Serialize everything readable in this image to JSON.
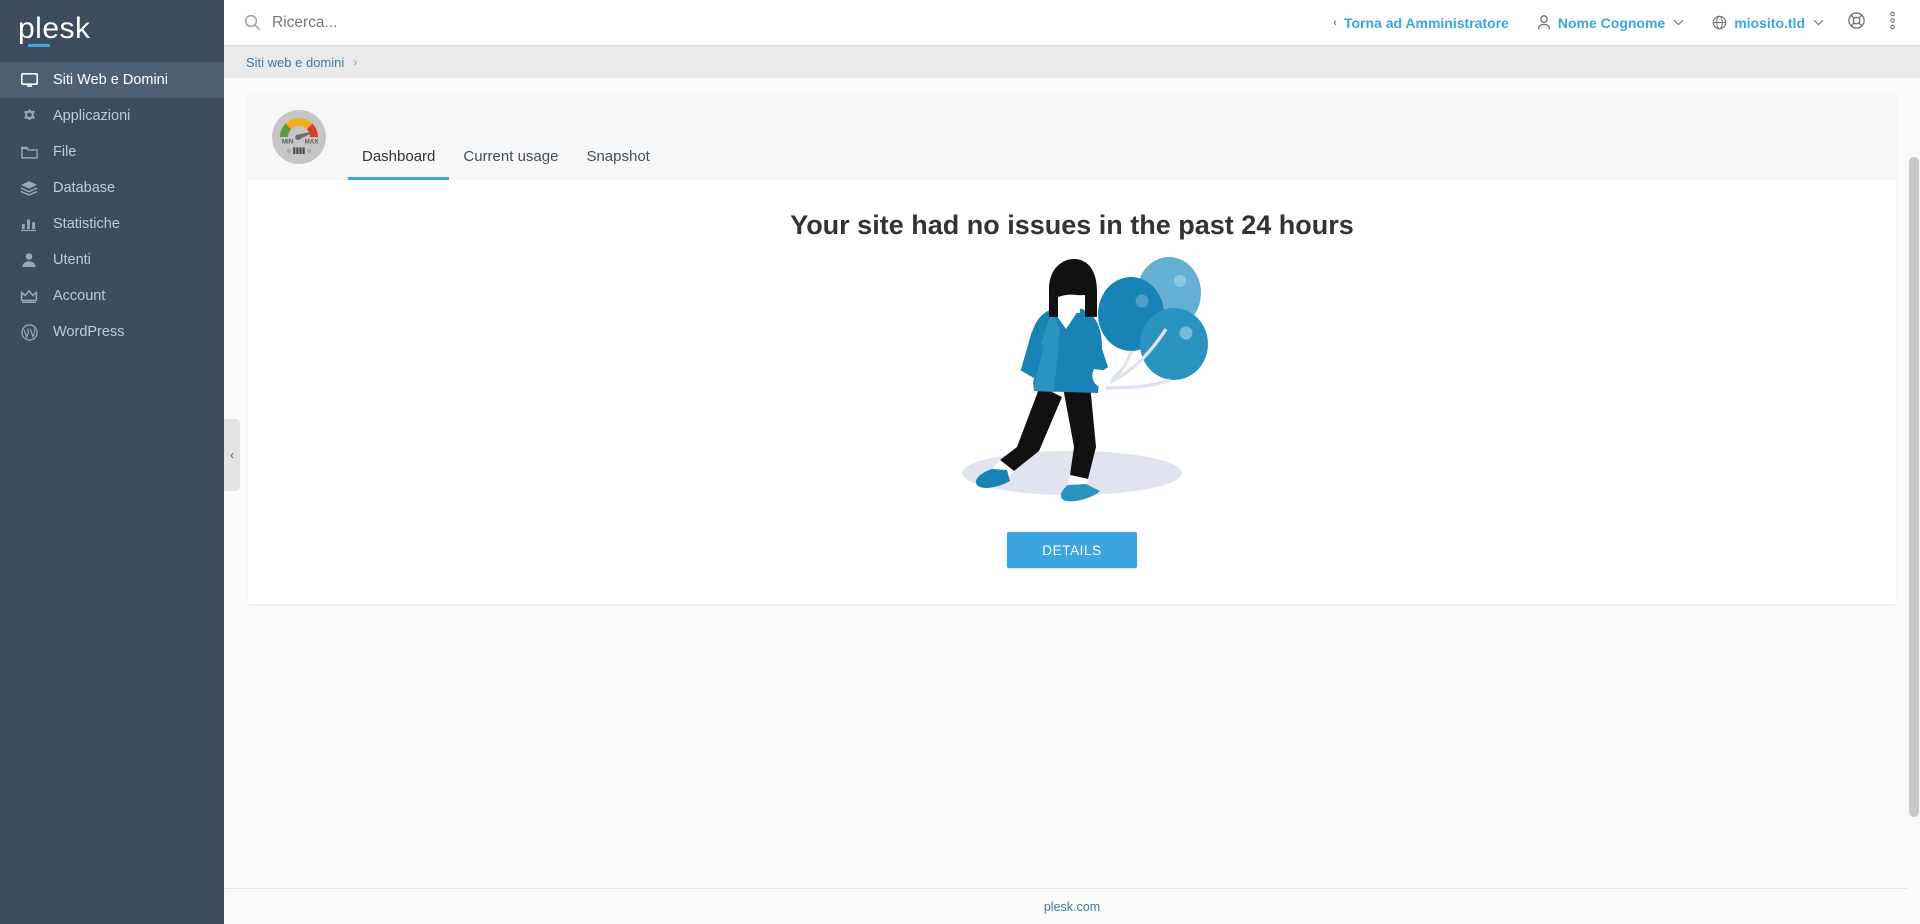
{
  "brand": {
    "name": "plesk"
  },
  "sidebar": {
    "items": [
      {
        "label": "Siti Web e Domini",
        "icon": "monitor-icon",
        "active": true
      },
      {
        "label": "Applicazioni",
        "icon": "gear-icon",
        "active": false
      },
      {
        "label": "File",
        "icon": "folder-icon",
        "active": false
      },
      {
        "label": "Database",
        "icon": "database-stack-icon",
        "active": false
      },
      {
        "label": "Statistiche",
        "icon": "bar-chart-icon",
        "active": false
      },
      {
        "label": "Utenti",
        "icon": "user-icon",
        "active": false
      },
      {
        "label": "Account",
        "icon": "crown-icon",
        "active": false
      },
      {
        "label": "WordPress",
        "icon": "wordpress-icon",
        "active": false
      }
    ],
    "collapse_label": "‹"
  },
  "topbar": {
    "search": {
      "placeholder": "Ricerca...",
      "value": "",
      "icon": "search-icon"
    },
    "back_to_admin": {
      "label": "Torna ad Amministratore",
      "prefix": "‹"
    },
    "user": {
      "label": "Nome Cognome",
      "icon": "user-icon",
      "caret": "⌄"
    },
    "domain": {
      "label": "miosito.tld",
      "icon": "globe-icon",
      "caret": "⌄"
    },
    "support": {
      "icon": "lifebuoy-icon"
    },
    "more": {
      "icon": "kebab-menu-icon"
    }
  },
  "breadcrumb": {
    "label": "Siti web e domini",
    "separator": "›"
  },
  "page": {
    "tabs": [
      {
        "label": "Dashboard",
        "active": true
      },
      {
        "label": "Current usage",
        "active": false
      },
      {
        "label": "Snapshot",
        "active": false
      }
    ],
    "gauge": {
      "icon": "speedometer-icon",
      "min_label": "MIN",
      "max_label": "MAX"
    },
    "headline": "Your site had no issues in the past 24 hours",
    "illustration": "person-with-balloons-illustration",
    "details_button": "DETAILS"
  },
  "footer": {
    "link": "plesk.com"
  },
  "colors": {
    "sidebar_bg": "#3b4c5e",
    "sidebar_active": "#4d6073",
    "accent": "#3ba5e0",
    "link": "#3e7a9e",
    "breadcrumb_bg": "#eaeaea",
    "card_head_bg": "#f5f7f9",
    "page_bg": "#fafafa",
    "headline": "#333333",
    "gauge_green": "#5a9e3e",
    "gauge_yellow": "#f0ad1e",
    "gauge_red": "#e03c25",
    "balloon_dark": "#1883b4",
    "balloon_light": "#63b0d4",
    "shadow_ellipse": "#e2e3f0"
  }
}
